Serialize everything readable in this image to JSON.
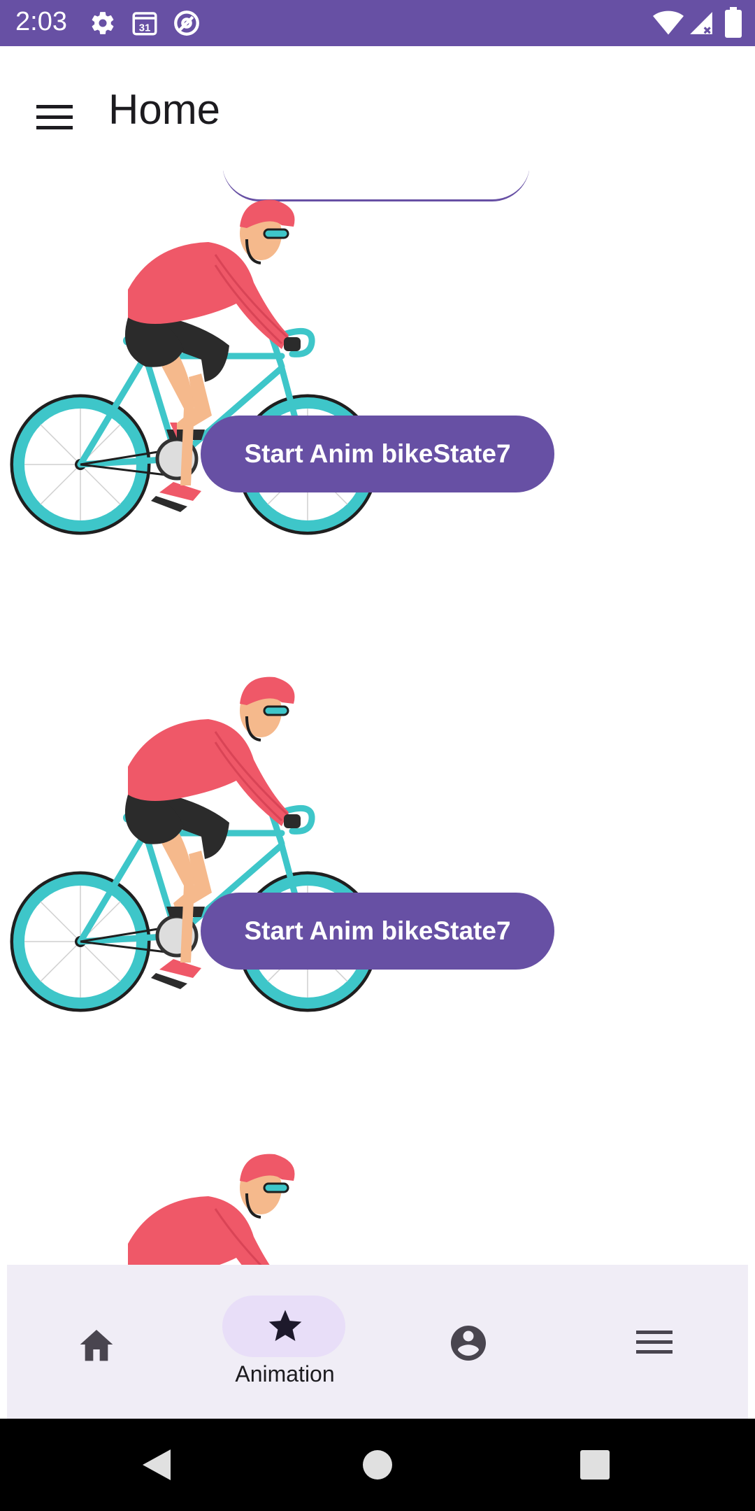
{
  "status_bar": {
    "time": "2:03",
    "icons": [
      "gear-icon",
      "calendar-icon",
      "at-sign-icon",
      "wifi-icon",
      "signal-icon",
      "battery-icon"
    ],
    "calendar_day": "31",
    "background_color": "#6750a4"
  },
  "app_bar": {
    "title": "Home",
    "menu_icon": "hamburger-menu-icon"
  },
  "content": {
    "image_description_names": [
      "cyclist-image",
      "cyclist-image",
      "cyclist-image"
    ],
    "buttons": [
      {
        "label": "Start Anim bikeState7"
      },
      {
        "label": "Start Anim bikeState7"
      }
    ]
  },
  "bottom_nav": {
    "items": [
      {
        "icon": "home-icon",
        "label": ""
      },
      {
        "icon": "star-icon",
        "label": "Animation",
        "selected": true
      },
      {
        "icon": "account-circle-icon",
        "label": ""
      },
      {
        "icon": "list-menu-icon",
        "label": ""
      }
    ],
    "indicator_color": "#e8def8",
    "background_color": "#f0edf6"
  },
  "system_nav": {
    "buttons": [
      "back-icon",
      "home-circle-icon",
      "recents-square-icon"
    ]
  },
  "colors": {
    "primary": "#6750a4",
    "on_primary": "#ffffff"
  }
}
